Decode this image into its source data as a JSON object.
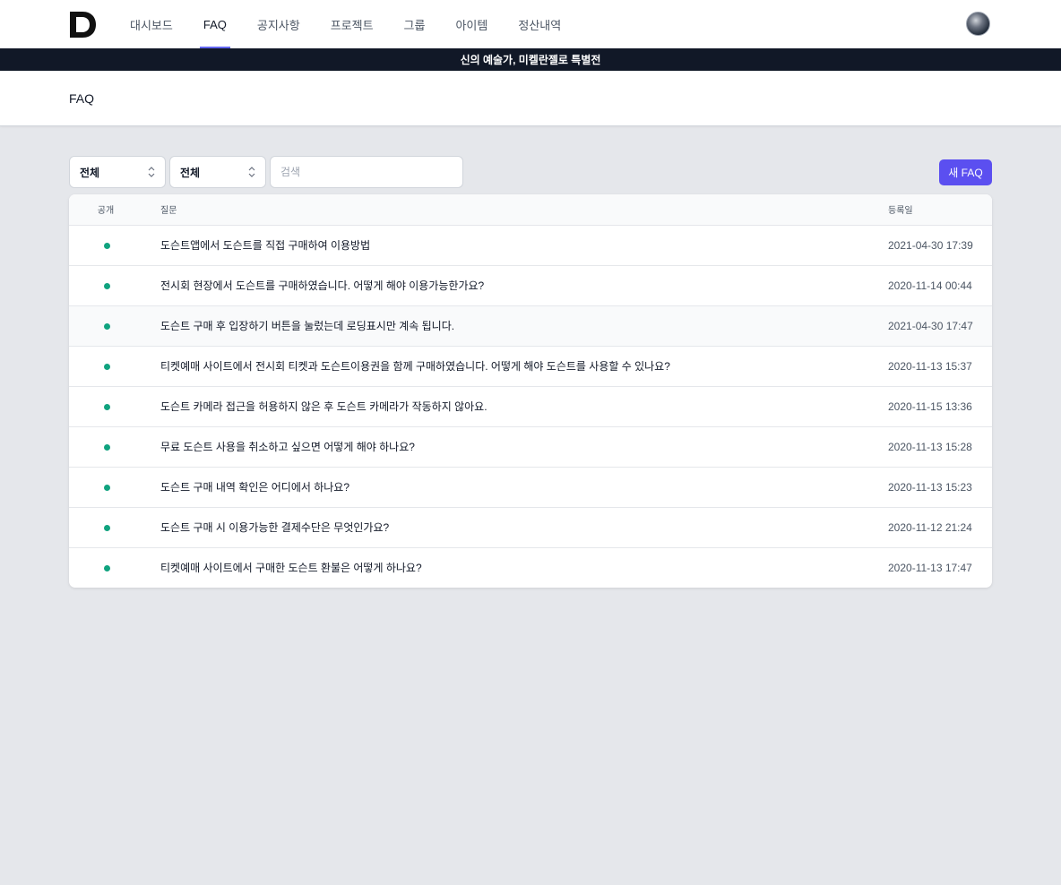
{
  "nav": {
    "items": [
      {
        "label": "대시보드",
        "name": "nav-dashboard",
        "active": false
      },
      {
        "label": "FAQ",
        "name": "nav-faq",
        "active": true
      },
      {
        "label": "공지사항",
        "name": "nav-notices",
        "active": false
      },
      {
        "label": "프로젝트",
        "name": "nav-projects",
        "active": false
      },
      {
        "label": "그룹",
        "name": "nav-groups",
        "active": false
      },
      {
        "label": "아이템",
        "name": "nav-items",
        "active": false
      },
      {
        "label": "정산내역",
        "name": "nav-settlements",
        "active": false
      }
    ]
  },
  "banner": {
    "text": "신의 예술가, 미켈란젤로 특별전"
  },
  "page": {
    "title": "FAQ"
  },
  "filters": {
    "select1": "전체",
    "select2": "전체",
    "search_placeholder": "검색"
  },
  "actions": {
    "new_faq": "새 FAQ"
  },
  "table": {
    "headers": {
      "public": "공개",
      "question": "질문",
      "date": "등록일"
    },
    "rows": [
      {
        "public": true,
        "question": "도슨트앱에서 도슨트를 직접 구매하여 이용방법",
        "date": "2021-04-30 17:39"
      },
      {
        "public": true,
        "question": "전시회 현장에서 도슨트를 구매하였습니다. 어떻게 해야 이용가능한가요?",
        "date": "2020-11-14 00:44"
      },
      {
        "public": true,
        "question": "도슨트 구매 후 입장하기 버튼을 눌렀는데 로딩표시만 계속 됩니다.",
        "date": "2021-04-30 17:47"
      },
      {
        "public": true,
        "question": "티켓예매 사이트에서 전시회 티켓과 도슨트이용권을 함께 구매하였습니다. 어떻게 해야 도슨트를 사용할 수 있나요?",
        "date": "2020-11-13 15:37"
      },
      {
        "public": true,
        "question": "도슨트 카메라 접근을 허용하지 않은 후 도슨트 카메라가 작동하지 않아요.",
        "date": "2020-11-15 13:36"
      },
      {
        "public": true,
        "question": "무료 도슨트 사용을 취소하고 싶으면 어떻게 해야 하나요?",
        "date": "2020-11-13 15:28"
      },
      {
        "public": true,
        "question": "도슨트 구매 내역 확인은 어디에서 하나요?",
        "date": "2020-11-13 15:23"
      },
      {
        "public": true,
        "question": "도슨트 구매 시 이용가능한 결제수단은 무엇인가요?",
        "date": "2020-11-12 21:24"
      },
      {
        "public": true,
        "question": "티켓예매 사이트에서 구매한 도슨트 환불은 어떻게 하나요?",
        "date": "2020-11-13 17:47"
      }
    ]
  },
  "colors": {
    "accent": "#5b4ff0",
    "banner_bg": "#111827",
    "status_public": "#10a37f",
    "page_bg": "#e5e7eb"
  },
  "icons": {
    "logo": "brand-d-logo",
    "avatar": "user-avatar",
    "select_chevron": "chevron-up-down-icon",
    "status": "status-dot-icon"
  }
}
